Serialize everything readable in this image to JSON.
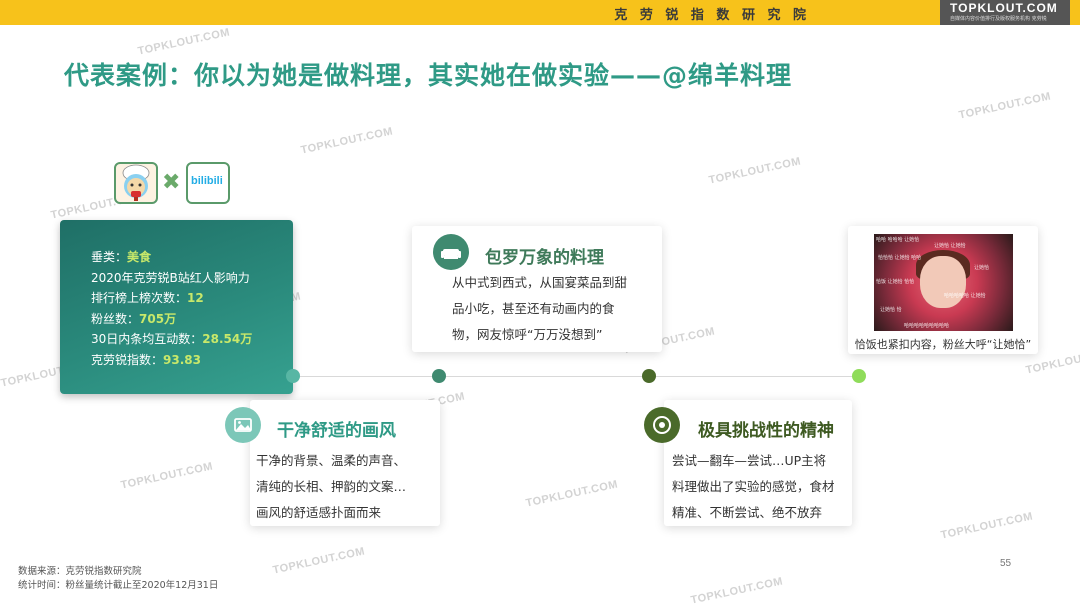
{
  "header": {
    "org_name": "克 劳 锐 指 数 研 究 院",
    "logo_text": "TOPKLOUT.COM",
    "logo_subtext": "自媒体内容价值排行及版权服务机构 克劳锐"
  },
  "title": "代表案例：你以为她是做料理，其实她在做实验——@绵羊料理",
  "watermark_text": "TOPKLOUT.COM",
  "logos": {
    "platform_text": "bilibili"
  },
  "stats": {
    "lines": [
      {
        "label": "垂类：",
        "value": "美食"
      },
      {
        "label": "2020年克劳锐B站红人影响力",
        "value": ""
      },
      {
        "label": "排行榜上榜次数：",
        "value": "12"
      },
      {
        "label": "粉丝数：",
        "value": "705万"
      },
      {
        "label": "30日内条均互动数：",
        "value": "28.54万"
      },
      {
        "label": "克劳锐指数：",
        "value": "93.83"
      }
    ]
  },
  "features": [
    {
      "title": "干净舒适的画风",
      "icon": "picture-icon",
      "color": "#2f9a86",
      "body": [
        "干净的背景、温柔的声音、",
        "清纯的长相、押韵的文案…",
        "画风的舒适感扑面而来"
      ]
    },
    {
      "title": "包罗万象的料理",
      "icon": "sofa-icon",
      "color": "#3f7a5a",
      "body": [
        "从中式到西式，从国宴菜品到甜",
        "品小吃，甚至还有动画内的食",
        "物，网友惊呼“万万没想到”"
      ]
    },
    {
      "title": "极具挑战性的精神",
      "icon": "target-icon",
      "color": "#4a6a2a",
      "body": [
        "尝试—翻车—尝试…UP主将",
        "料理做出了实验的感觉，食材",
        "精准、不断尝试、绝不放弃"
      ]
    }
  ],
  "timeline_colors": [
    "#58b6a4",
    "#3f8a70",
    "#4a6a2a",
    "#8fdc5a"
  ],
  "screenshot": {
    "caption": "恰饭也紧扣内容，粉丝大呼“让她恰”",
    "danmaku": [
      "哈哈 哈哈哈 让她恰",
      "让她恰 让她恰",
      "恰恰恰 让她恰 哈哈",
      "让她恰",
      "恰饭 让她恰 恰恰",
      "哈哈哈哈哈 让她恰",
      "让她恰 恰",
      "哈哈哈哈哈哈哈哈哈"
    ]
  },
  "footer": {
    "source": "数据来源：克劳锐指数研究院",
    "period": "统计时间：粉丝量统计截止至2020年12月31日",
    "page_number": "55"
  }
}
